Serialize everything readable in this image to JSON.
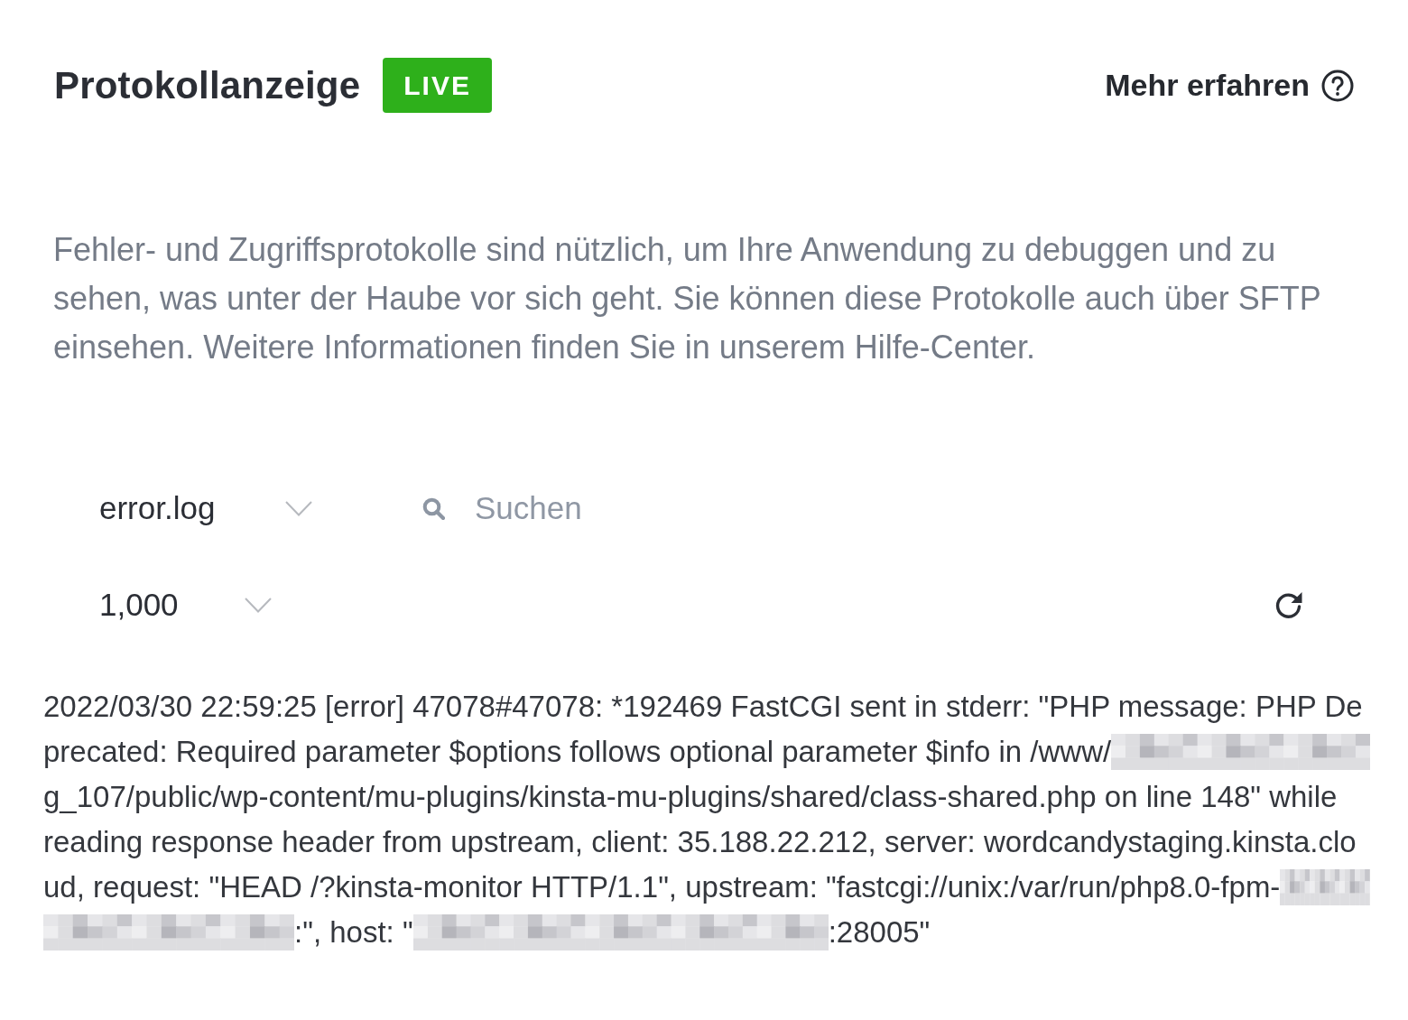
{
  "header": {
    "title": "Protokollanzeige",
    "badge": "LIVE",
    "help_link": "Mehr erfahren"
  },
  "description": "Fehler- und Zugriffsprotokolle sind nützlich, um Ihre Anwendung zu debuggen und zu sehen, was unter der Haube vor sich geht. Sie können diese Protokolle auch über SFTP einsehen. Weitere Informationen finden Sie in unserem Hilfe-Center.",
  "filters": {
    "log_file": {
      "value": "error.log"
    },
    "search": {
      "placeholder": "Suchen"
    },
    "line_count": {
      "value": "1,000"
    }
  },
  "log": {
    "lines": [
      {
        "segments": [
          {
            "kind": "text",
            "text": "2022/03/30 22:59:25 [error] 47078#47078: *192469 FastCGI sent in stderr: \"PHP message: PHP De"
          }
        ]
      },
      {
        "segments": [
          {
            "kind": "text",
            "text": "precated: Required parameter $options follows optional parameter $info in /www/"
          },
          {
            "kind": "redacted"
          }
        ]
      },
      {
        "segments": [
          {
            "kind": "text",
            "text": "g_107/public/wp-content/mu-plugins/kinsta-mu-plugins/shared/class-shared.php on line 148\" while"
          }
        ]
      },
      {
        "segments": [
          {
            "kind": "text",
            "text": "reading response header from upstream, client: 35.188.22.212, server: wordcandystaging.kinsta.clo"
          }
        ]
      },
      {
        "segments": [
          {
            "kind": "text",
            "text": "ud, request: \"HEAD /?kinsta-monitor HTTP/1.1\", upstream: \"fastcgi://unix:/var/run/php8.0-fpm-"
          },
          {
            "kind": "redacted"
          }
        ]
      },
      {
        "segments": [
          {
            "kind": "redacted"
          },
          {
            "kind": "text",
            "text": ":\", host: \""
          },
          {
            "kind": "redacted"
          },
          {
            "kind": "text",
            "text": ":28005\""
          }
        ]
      }
    ]
  }
}
